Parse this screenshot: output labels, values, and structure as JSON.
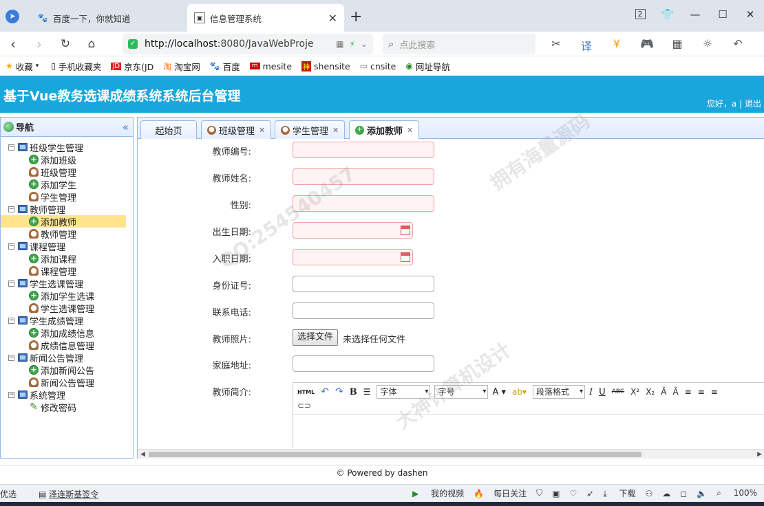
{
  "browser": {
    "tabs": [
      {
        "title": "百度一下，你就知道",
        "icon": "baidu-paw-icon",
        "active": false
      },
      {
        "title": "信息管理系统",
        "icon": "page-icon",
        "active": true
      }
    ],
    "tab_count": "2",
    "url_host": "http://localhost",
    "url_rest": ":8080/JavaWebProje",
    "search_placeholder": "点此搜索",
    "bookmarks": [
      {
        "label": "收藏",
        "icon": "star-icon"
      },
      {
        "label": "手机收藏夹",
        "icon": "phone-icon"
      },
      {
        "label": "京东(JD",
        "icon": "jd-icon"
      },
      {
        "label": "淘宝网",
        "icon": "taobao-icon"
      },
      {
        "label": "百度",
        "icon": "baidu-paw-icon"
      },
      {
        "label": "mesite",
        "icon": "mesite-icon"
      },
      {
        "label": "shensite",
        "icon": "shensite-icon"
      },
      {
        "label": "cnsite",
        "icon": "doc-icon"
      },
      {
        "label": "网址导航",
        "icon": "compass-icon"
      }
    ],
    "status_left": [
      "优选",
      "泽连斯基签令"
    ],
    "status_right": [
      "我的视频",
      "每日关注",
      "下载",
      "100%"
    ]
  },
  "app": {
    "title": "基于Vue教务选课成绩系统系统后台管理",
    "greeting": "您好，",
    "username": "a",
    "separator": "|",
    "logout": "退出"
  },
  "sidebar": {
    "title": "导航",
    "collapse_glyph": "«",
    "groups": [
      {
        "label": "班级学生管理",
        "items": [
          {
            "label": "添加班级",
            "icon": "add-icon"
          },
          {
            "label": "班级管理",
            "icon": "user-icon"
          },
          {
            "label": "添加学生",
            "icon": "add-icon"
          },
          {
            "label": "学生管理",
            "icon": "user-icon"
          }
        ]
      },
      {
        "label": "教师管理",
        "items": [
          {
            "label": "添加教师",
            "icon": "add-icon",
            "selected": true
          },
          {
            "label": "教师管理",
            "icon": "user-icon"
          }
        ]
      },
      {
        "label": "课程管理",
        "items": [
          {
            "label": "添加课程",
            "icon": "add-icon"
          },
          {
            "label": "课程管理",
            "icon": "user-icon"
          }
        ]
      },
      {
        "label": "学生选课管理",
        "items": [
          {
            "label": "添加学生选课",
            "icon": "add-icon"
          },
          {
            "label": "学生选课管理",
            "icon": "user-icon"
          }
        ]
      },
      {
        "label": "学生成绩管理",
        "items": [
          {
            "label": "添加成绩信息",
            "icon": "add-icon"
          },
          {
            "label": "成绩信息管理",
            "icon": "user-icon"
          }
        ]
      },
      {
        "label": "新闻公告管理",
        "items": [
          {
            "label": "添加新闻公告",
            "icon": "add-icon"
          },
          {
            "label": "新闻公告管理",
            "icon": "user-icon"
          }
        ]
      },
      {
        "label": "系统管理",
        "items": [
          {
            "label": "修改密码",
            "icon": "pencil-icon"
          }
        ]
      }
    ]
  },
  "content_tabs": [
    {
      "label": "起始页",
      "icon": "",
      "closable": false
    },
    {
      "label": "班级管理",
      "icon": "user-icon",
      "closable": true
    },
    {
      "label": "学生管理",
      "icon": "user-icon",
      "closable": true
    },
    {
      "label": "添加教师",
      "icon": "add-icon",
      "closable": true,
      "active": true
    }
  ],
  "form": {
    "teacher_no_label": "教师编号:",
    "teacher_no_value": "",
    "name_label": "教师姓名:",
    "name_value": "",
    "gender_label": "性别:",
    "gender_value": "",
    "birth_label": "出生日期:",
    "birth_value": "",
    "hire_label": "入职日期:",
    "hire_value": "",
    "id_card_label": "身份证号:",
    "id_card_value": "",
    "phone_label": "联系电话:",
    "phone_value": "",
    "photo_label": "教师照片:",
    "photo_button": "选择文件",
    "photo_status": "未选择任何文件",
    "address_label": "家庭地址:",
    "address_value": "",
    "intro_label": "教师简介:",
    "editor": {
      "html_btn": "HTML",
      "bold": "B",
      "font_family": "字体",
      "font_size": "字号",
      "font_color": "A",
      "paragraph": "段落格式",
      "italic": "I",
      "underline": "U",
      "strike": "ABC",
      "superscript": "X²",
      "subscript": "X₂"
    }
  },
  "footer": "© Powered by dashen",
  "watermark": [
    "QQ:254540457",
    "拥有海量源码",
    "大神计算机设计"
  ]
}
